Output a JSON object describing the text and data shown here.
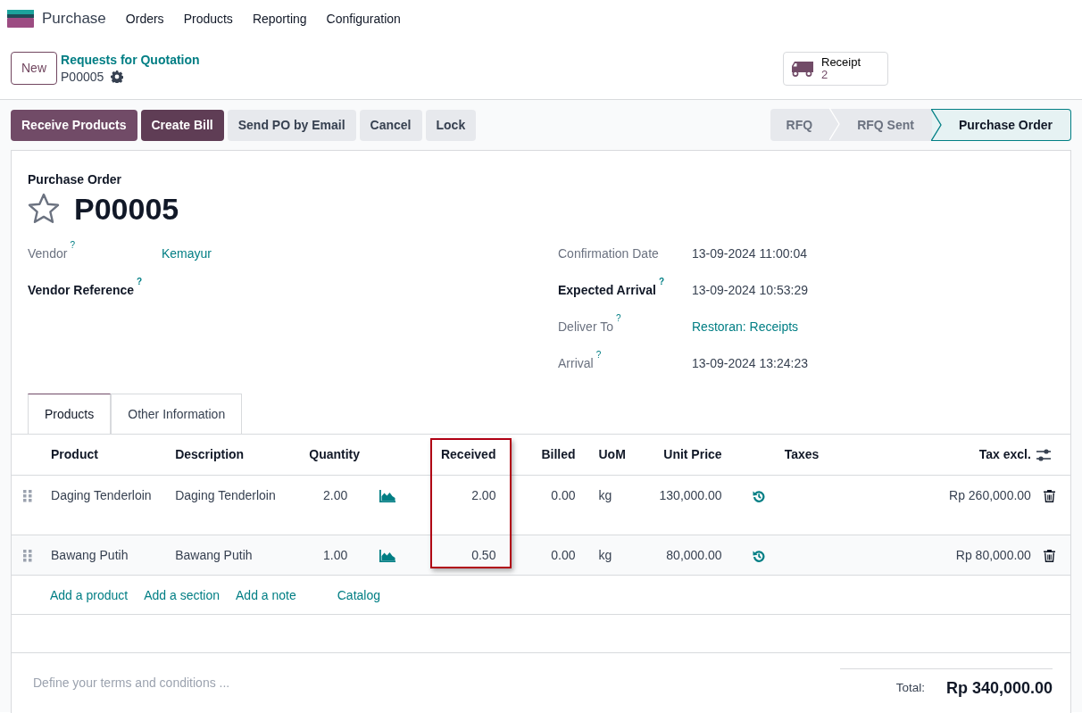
{
  "navbar": {
    "app": "Purchase",
    "menu": [
      "Orders",
      "Products",
      "Reporting",
      "Configuration"
    ]
  },
  "control_panel": {
    "new_button": "New",
    "breadcrumb": "Requests for Quotation",
    "record": "P00005",
    "smart_button": {
      "label": "Receipt",
      "count": "2"
    }
  },
  "actions": [
    {
      "label": "Receive Products",
      "kind": "primary"
    },
    {
      "label": "Create Bill",
      "kind": "primary"
    },
    {
      "label": "Send PO by Email",
      "kind": "secondary"
    },
    {
      "label": "Cancel",
      "kind": "secondary"
    },
    {
      "label": "Lock",
      "kind": "secondary"
    }
  ],
  "stages": [
    {
      "label": "RFQ",
      "selected": false
    },
    {
      "label": "RFQ Sent",
      "selected": false
    },
    {
      "label": "Purchase Order",
      "selected": true
    }
  ],
  "form": {
    "subtitle": "Purchase Order",
    "title": "P00005",
    "favorite": false,
    "left_fields": [
      {
        "label": "Vendor",
        "help": "?",
        "value": "Kemayur",
        "readonly": true,
        "link": true
      },
      {
        "label": "Vendor Reference",
        "help": "?",
        "readonly": false
      }
    ],
    "right_fields": [
      {
        "label": "Confirmation Date",
        "value": "13-09-2024 11:00:04",
        "readonly": true,
        "link": false
      },
      {
        "label": "Expected Arrival",
        "help": "?",
        "value": "13-09-2024 10:53:29",
        "readonly": false,
        "link": false
      },
      {
        "label": "Deliver To",
        "help": "?",
        "value": "Restoran: Receipts",
        "readonly": true,
        "link": true
      },
      {
        "label": "Arrival",
        "help": "?",
        "value": "13-09-2024 13:24:23",
        "readonly": true,
        "link": false
      }
    ]
  },
  "tabs": [
    {
      "label": "Products",
      "selected": true
    },
    {
      "label": "Other Information",
      "selected": false
    }
  ],
  "table": {
    "columns": [
      {
        "label": "Product"
      },
      {
        "label": "Description"
      },
      {
        "label": "Quantity"
      },
      {
        "label": "Received",
        "highlight": true
      },
      {
        "label": "Billed"
      },
      {
        "label": "UoM"
      },
      {
        "label": "Unit Price"
      },
      {
        "label": "Taxes"
      },
      {
        "label": "Tax excl."
      }
    ],
    "rows": [
      {
        "product": "Daging Tenderloin",
        "description": "Daging Tenderloin",
        "quantity": "2.00",
        "received": "2.00",
        "billed": "0.00",
        "uom": "kg",
        "unit_price": "130,000.00",
        "taxes": null,
        "subtotal": "Rp 260,000.00"
      },
      {
        "product": "Bawang Putih",
        "description": "Bawang Putih",
        "quantity": "1.00",
        "received": "0.50",
        "billed": "0.00",
        "uom": "kg",
        "unit_price": "80,000.00",
        "taxes": null,
        "subtotal": "Rp 80,000.00"
      }
    ],
    "add_links": [
      "Add a product",
      "Add a section",
      "Add a note",
      "Catalog"
    ]
  },
  "terms": {
    "placeholder": "Define your terms and conditions ..."
  },
  "total": {
    "label": "Total:",
    "value": "Rp 340,000.00"
  }
}
